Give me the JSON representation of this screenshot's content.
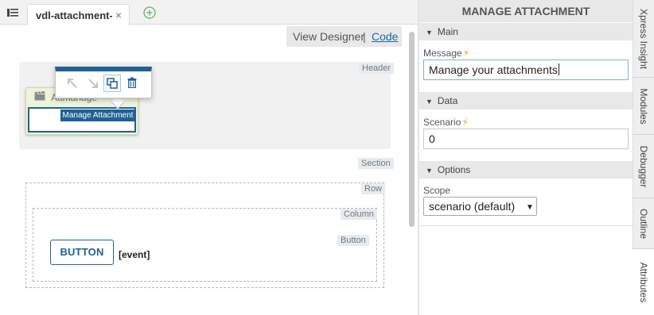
{
  "tabbar": {
    "file_tab_label": "vdl-attachment-demo",
    "close_glyph": "×"
  },
  "view_switch": {
    "designer_label": "View Designer",
    "separator": "|",
    "code_label": "Code"
  },
  "canvas": {
    "zone_tags": {
      "header": "Header",
      "section": "Section",
      "row": "Row",
      "column": "Column",
      "button": "Button"
    },
    "component": {
      "label": "Attmanage",
      "selected_label": "Manage Attachment",
      "icon": "clapperboard-icon"
    },
    "popover": {
      "actions": [
        "move-up-icon",
        "move-down-icon",
        "copy-icon",
        "trash-icon"
      ]
    },
    "button_label": "BUTTON",
    "event_label": "[event]"
  },
  "panel": {
    "title": "MANAGE ATTACHMENT",
    "groups": {
      "main": "Main",
      "data": "Data",
      "options": "Options"
    },
    "fields": {
      "message_label": "Message",
      "message_value": "Manage your attachments",
      "scenario_label": "Scenario",
      "scenario_value": "0",
      "scope_label": "Scope",
      "scope_value": "scenario (default)"
    },
    "bolt_icon": "lightning-bolt-icon"
  },
  "side_tabs": [
    "Xpress Insight",
    "Modules",
    "Debugger",
    "Outline",
    "Attributes"
  ],
  "colors": {
    "accent": "#1f6194",
    "bolt": "#f0a500",
    "link": "#1a6aab"
  }
}
